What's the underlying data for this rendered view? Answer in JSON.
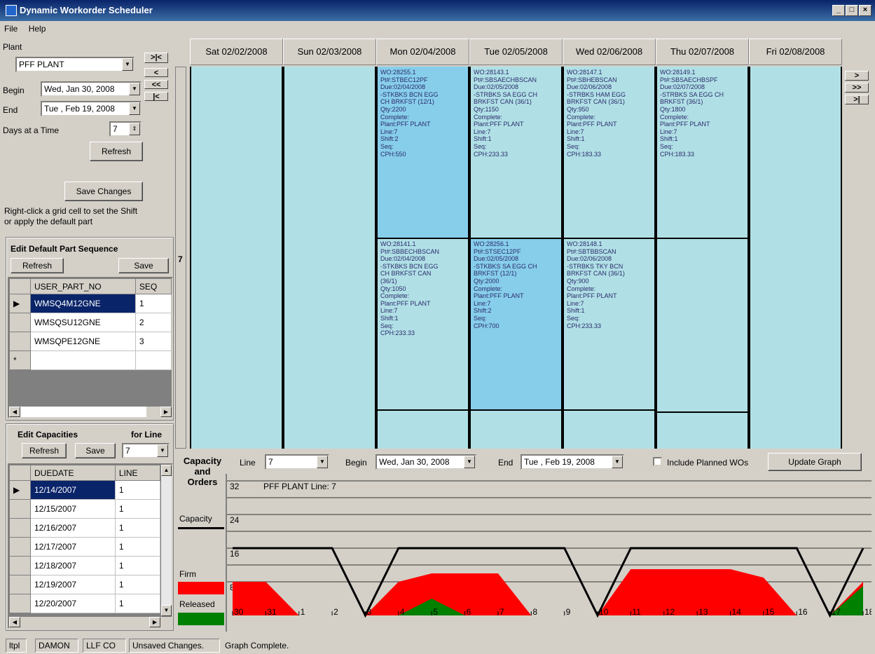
{
  "window": {
    "title": "Dynamic Workorder Scheduler"
  },
  "menu": [
    "File",
    "Help"
  ],
  "left_panel": {
    "plant_label": "Plant",
    "plant_value": "PFF PLANT",
    "begin_label": "Begin",
    "begin_value": "Wed, Jan 30, 2008",
    "end_label": "End",
    "end_value": "Tue , Feb 19, 2008",
    "days_label": "Days at a Time",
    "days_value": "7",
    "refresh_label": "Refresh",
    "save_changes_label": "Save Changes",
    "hint": "Right-click a grid cell to set the Shift or apply the default part",
    "side_number": "7"
  },
  "nav": {
    "first_page": ">|<",
    "prev": "<",
    "prev_page": "<<",
    "first": "|<",
    "next": ">",
    "next_page": ">>",
    "last": ">|"
  },
  "default_part": {
    "title": "Edit Default Part Sequence",
    "refresh_label": "Refresh",
    "save_label": "Save",
    "columns": [
      "USER_PART_NO",
      "SEQ"
    ],
    "rows": [
      {
        "part": "WMSQ4M12GNE",
        "seq": "1"
      },
      {
        "part": "WMSQSU12GNE",
        "seq": "2"
      },
      {
        "part": "WMSQPE12GNE",
        "seq": "3"
      }
    ],
    "new_row_marker": "*"
  },
  "capacities": {
    "title": "Edit Capacities",
    "for_line_label": "for Line",
    "refresh_label": "Refresh",
    "save_label": "Save",
    "line_value": "7",
    "columns": [
      "DUEDATE",
      "LINE"
    ],
    "rows": [
      {
        "date": "12/14/2007",
        "line": "1"
      },
      {
        "date": "12/15/2007",
        "line": "1"
      },
      {
        "date": "12/16/2007",
        "line": "1"
      },
      {
        "date": "12/17/2007",
        "line": "1"
      },
      {
        "date": "12/18/2007",
        "line": "1"
      },
      {
        "date": "12/19/2007",
        "line": "1"
      },
      {
        "date": "12/20/2007",
        "line": "1"
      }
    ]
  },
  "days": [
    {
      "label": "Sat 02/02/2008",
      "cards": []
    },
    {
      "label": "Sun 02/03/2008",
      "cards": []
    },
    {
      "label": "Mon 02/04/2008",
      "cards": [
        {
          "text": "WO:28255.1\nPt#:STBEC12PF\nDue:02/04/2008\n-STKBKS BCN EGG\nCH BRKFST (12/1)\nQty:2200\nComplete:\nPlant:PFF PLANT\nLine:7\nShift:2\nSeq:\nCPH:550",
          "selected": true
        },
        {
          "text": "WO:28141.1\nPt#:SBBECHBSCAN\nDue:02/04/2008\n-STKBKS BCN EGG\nCH BRKFST CAN\n(36/1)\nQty:1050\nComplete:\nPlant:PFF PLANT\nLine:7\nShift:1\nSeq:\nCPH:233.33",
          "selected": false
        }
      ]
    },
    {
      "label": "Tue 02/05/2008",
      "cards": [
        {
          "text": "WO:28143.1\nPt#:SBSAECHBSCAN\nDue:02/05/2008\n-STRBKS SA EGG CH\nBRKFST CAN (36/1)\nQty:1150\nComplete:\nPlant:PFF PLANT\nLine:7\nShift:1\nSeq:\nCPH:233.33",
          "selected": false
        },
        {
          "text": "WO:28256.1\nPt#:STSEC12PF\nDue:02/05/2008\n-STKBKS SA EGG CH\nBRKFST (12/1)\nQty:2000\nComplete:\nPlant:PFF PLANT\nLine:7\nShift:2\nSeq:\nCPH:700",
          "selected": true
        }
      ]
    },
    {
      "label": "Wed 02/06/2008",
      "cards": [
        {
          "text": "WO:28147.1\nPt#:SBHEBSCAN\nDue:02/06/2008\n-STRBKS HAM EGG\nBRKFST CAN (36/1)\nQty:950\nComplete:\nPlant:PFF PLANT\nLine:7\nShift:1\nSeq:\nCPH:183.33",
          "selected": false
        },
        {
          "text": "WO:28148.1\nPt#:SBTBBSCAN\nDue:02/06/2008\n-STRBKS TKY BCN\nBRKFST CAN (36/1)\nQty:900\nComplete:\nPlant:PFF PLANT\nLine:7\nShift:1\nSeq:\nCPH:233.33",
          "selected": false
        }
      ]
    },
    {
      "label": "Thu 02/07/2008",
      "cards": [
        {
          "text": "WO:28149.1\nPt#:SBSAECHBSPF\nDue:02/07/2008\n-STRBKS SA EGG CH\nBRKFST (36/1)\nQty:1800\nComplete:\nPlant:PFF PLANT\nLine:7\nShift:1\nSeq:\nCPH:183.33",
          "selected": false
        }
      ]
    },
    {
      "label": "Fri 02/08/2008",
      "cards": []
    }
  ],
  "graph_controls": {
    "section_label": "Capacity and Orders",
    "line_label": "Line",
    "line_value": "7",
    "begin_label": "Begin",
    "begin_value": "Wed, Jan 30, 2008",
    "end_label": "End",
    "end_value": "Tue , Feb 19, 2008",
    "include_planned_label": "Include Planned WOs",
    "include_planned_checked": false,
    "update_label": "Update Graph"
  },
  "legend": {
    "capacity": "Capacity",
    "firm": "Firm",
    "released": "Released",
    "firm_color": "#ff0000",
    "released_color": "#008000",
    "capacity_color": "#000000"
  },
  "chart_data": {
    "type": "area",
    "title": "PFF PLANT Line: 7",
    "y_ticks": [
      "32",
      "24",
      "16",
      "8"
    ],
    "ylim": [
      0,
      32
    ],
    "x": [
      "30",
      "31",
      "1",
      "2",
      "3",
      "4",
      "5",
      "6",
      "7",
      "8",
      "9",
      "10",
      "11",
      "12",
      "13",
      "14",
      "15",
      "16",
      "17",
      "18"
    ],
    "series": [
      {
        "name": "Capacity",
        "values": [
          16,
          16,
          16,
          16,
          0,
          16,
          16,
          16,
          16,
          16,
          16,
          0,
          16,
          16,
          16,
          16,
          16,
          16,
          0,
          16
        ]
      },
      {
        "name": "Firm",
        "values": [
          8,
          8,
          0,
          0,
          0,
          8,
          10,
          10,
          10,
          0,
          0,
          0,
          11,
          11,
          11,
          11,
          9,
          0,
          0,
          8
        ]
      },
      {
        "name": "Released",
        "values": [
          0,
          0,
          0,
          0,
          0,
          0,
          4,
          0,
          0,
          0,
          0,
          0,
          0,
          0,
          0,
          0,
          0,
          0,
          0,
          7
        ]
      }
    ]
  },
  "status": {
    "cells": [
      "ltpl",
      "DAMON",
      "LLF CO",
      "Unsaved Changes."
    ],
    "message": "Graph Complete."
  }
}
